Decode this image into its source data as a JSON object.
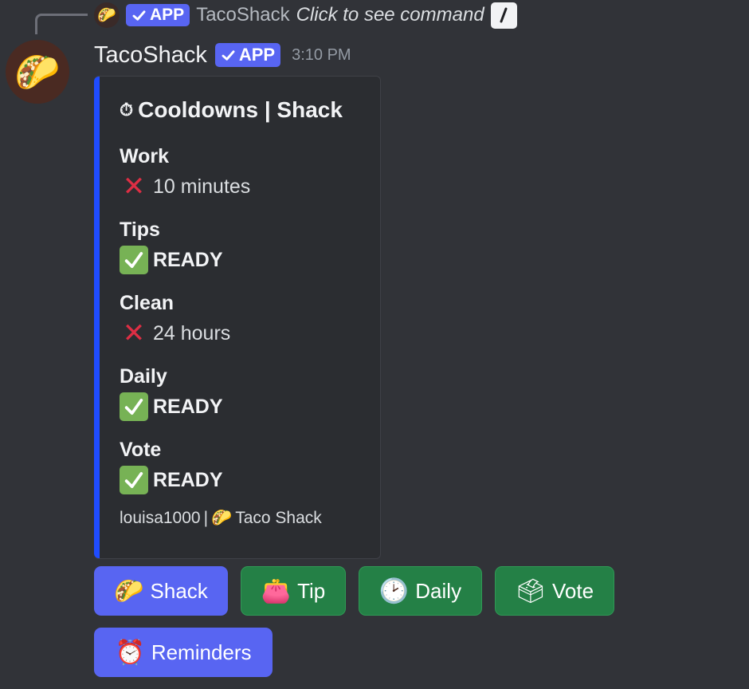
{
  "reply": {
    "app_tag": "APP",
    "username": "TacoShack",
    "command_text": "Click to see command"
  },
  "message": {
    "username": "TacoShack",
    "app_tag": "APP",
    "timestamp": "3:10 PM"
  },
  "embed": {
    "accent_color": "#1f4cff",
    "title_icon": "stopwatch-icon",
    "title": "Cooldowns | Shack",
    "fields": [
      {
        "name": "Work",
        "value": "10 minutes",
        "status": "cross"
      },
      {
        "name": "Tips",
        "value": "READY",
        "status": "check"
      },
      {
        "name": "Clean",
        "value": "24 hours",
        "status": "cross"
      },
      {
        "name": "Daily",
        "value": "READY",
        "status": "check"
      },
      {
        "name": "Vote",
        "value": "READY",
        "status": "check"
      }
    ],
    "footer_user": "louisa1000",
    "footer_separator": "|",
    "footer_shop": "Taco Shack"
  },
  "buttons": [
    {
      "label": "Shack",
      "icon": "taco-icon",
      "style": "primary"
    },
    {
      "label": "Tip",
      "icon": "purse-icon",
      "style": "success"
    },
    {
      "label": "Daily",
      "icon": "clock-icon",
      "style": "success"
    },
    {
      "label": "Vote",
      "icon": "ballot-box-icon",
      "style": "success"
    },
    {
      "label": "Reminders",
      "icon": "alarm-clock-icon",
      "style": "primary"
    }
  ],
  "colors": {
    "background": "#313338",
    "embed_background": "#2b2d31",
    "primary_button": "#5865f2",
    "success_button": "#248046",
    "app_tag": "#5865f2"
  }
}
